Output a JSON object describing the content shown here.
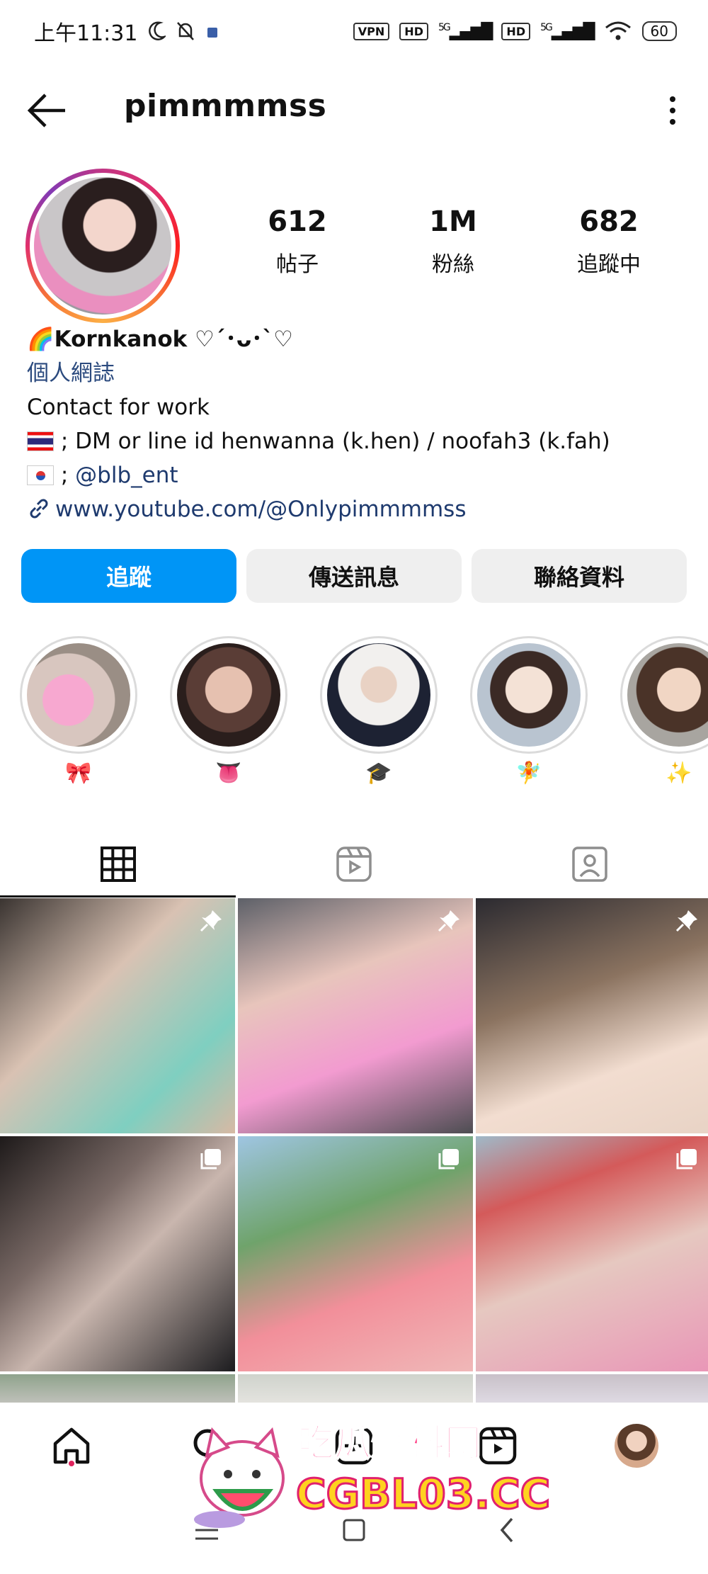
{
  "status_bar": {
    "time": "上午11:31",
    "vpn": "VPN",
    "hd1": "HD",
    "net1": "5G",
    "hd2": "HD",
    "net2": "5G",
    "battery": "60"
  },
  "header": {
    "username": "pimmmmss"
  },
  "stats": {
    "posts": {
      "value": "612",
      "label": "帖子"
    },
    "followers": {
      "value": "1M",
      "label": "粉絲"
    },
    "following": {
      "value": "682",
      "label": "追蹤中"
    }
  },
  "bio": {
    "name": "🌈Kornkanok ♡´･ᴗ･`♡",
    "category": "個人網誌",
    "line1": "Contact for work",
    "line2": " ; DM or line id henwanna (k.hen) / noofah3 (k.fah)",
    "line3_prefix": " ; ",
    "line3_mention": "@blb_ent",
    "link": "www.youtube.com/@Onlypimmmmss"
  },
  "actions": {
    "follow": "追蹤",
    "message": "傳送訊息",
    "contact": "聯絡資料"
  },
  "highlights": [
    {
      "emoji": "🎀",
      "color_a": "#f7a8d0",
      "color_b": "#9a8e85"
    },
    {
      "emoji": "👅",
      "color_a": "#e6c1b0",
      "color_b": "#3a2a28"
    },
    {
      "emoji": "🎓",
      "color_a": "#f2f0ee",
      "color_b": "#1d2233"
    },
    {
      "emoji": "🧚",
      "color_a": "#f4e2d6",
      "color_b": "#8e9aa8"
    },
    {
      "emoji": "✨",
      "color_a": "#f1d6c4",
      "color_b": "#4a3328"
    }
  ],
  "tabs": [
    "posts-grid",
    "reels",
    "tagged"
  ],
  "grid": [
    {
      "pinned": true,
      "bg": "linear-gradient(135deg,#3a3431 0%,#d9c2b3 40%,#7fcfc0 75%,#d7b9a4 100%)"
    },
    {
      "pinned": true,
      "bg": "linear-gradient(160deg,#5d6068 0%,#e8c5bc 35%,#f29bd0 65%,#4d4d52 100%)"
    },
    {
      "pinned": true,
      "bg": "linear-gradient(160deg,#2b2a30 0%,#8b7360 40%,#f2ddd0 70%,#e8d3c5 100%)"
    },
    {
      "pinned": false,
      "bg": "linear-gradient(135deg,#1e1a1a 0%,#7a6a66 35%,#c9b6ae 55%,#1c1c1f 100%)"
    },
    {
      "pinned": false,
      "bg": "linear-gradient(160deg,#9fc5e2 0%,#6fa36b 35%,#f28f9a 65%,#f0b8b8 100%)"
    },
    {
      "pinned": false,
      "bg": "linear-gradient(160deg,#9fb9c8 0%,#d45a5a 25%,#e6c8c0 55%,#e996b7 100%)"
    },
    {
      "pinned": false,
      "bg": "linear-gradient(#8fa38c,#c8c6c2)"
    },
    {
      "pinned": false,
      "bg": "linear-gradient(#cfd3cc,#e8e6e2)"
    },
    {
      "pinned": false,
      "bg": "linear-gradient(#c8c0c8,#e3dfe8)"
    }
  ],
  "watermark": {
    "title": "吃瓜爆料网",
    "url": "CGBL03.CC"
  },
  "colors": {
    "follow_button": "#0095f6",
    "secondary_button": "#efefef"
  }
}
